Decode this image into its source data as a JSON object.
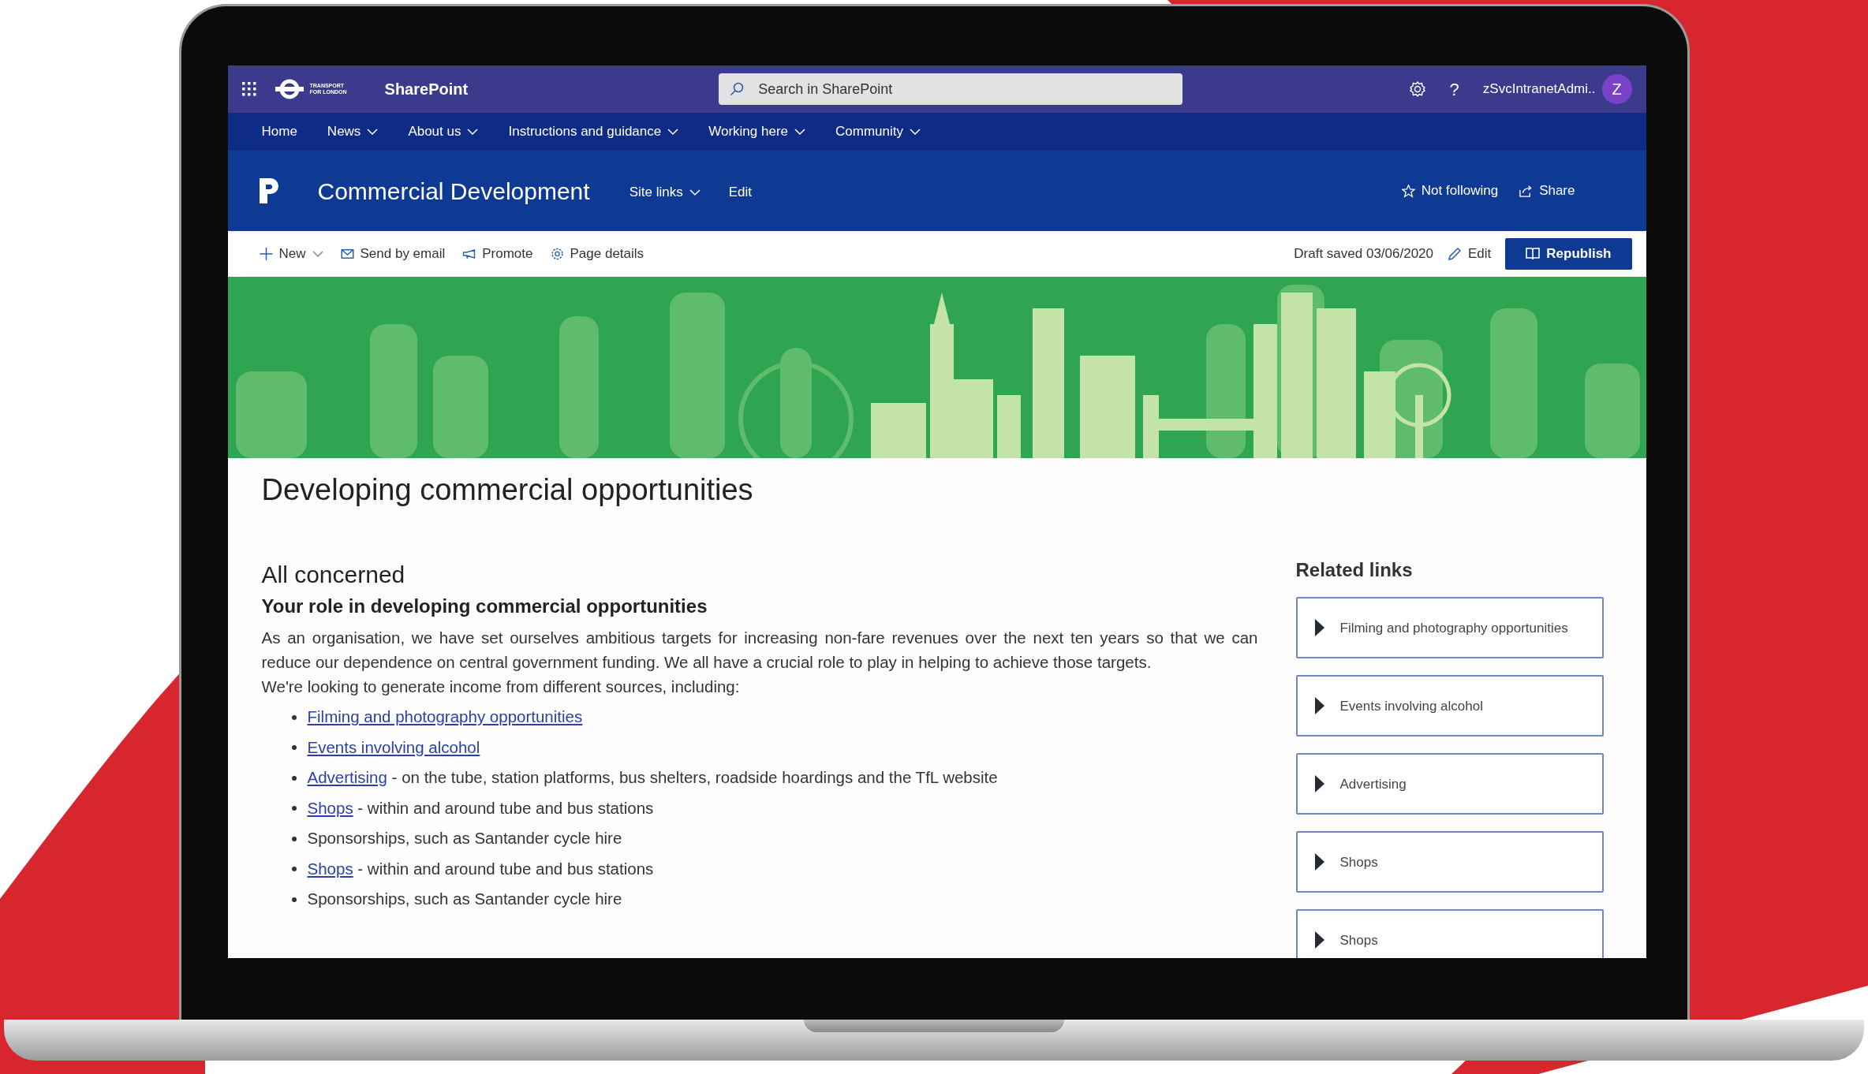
{
  "suite_bar": {
    "logo_text": [
      "TRANSPORT",
      "FOR LONDON"
    ],
    "app_name": "SharePoint",
    "search": {
      "placeholder": "Search in SharePoint"
    },
    "help": "?",
    "user": "zSvcIntranetAdmi..",
    "avatar": "Z"
  },
  "nav": [
    {
      "label": "Home",
      "has_menu": false
    },
    {
      "label": "News",
      "has_menu": true
    },
    {
      "label": "About us",
      "has_menu": true
    },
    {
      "label": "Instructions and guidance",
      "has_menu": true
    },
    {
      "label": "Working here",
      "has_menu": true
    },
    {
      "label": "Community",
      "has_menu": true
    }
  ],
  "site_header": {
    "title": "Commercial Development",
    "links": [
      {
        "label": "Site links",
        "has_menu": true
      },
      {
        "label": "Edit",
        "has_menu": false
      }
    ],
    "actions": [
      {
        "label": "Not following",
        "kind": "follow"
      },
      {
        "label": "Share",
        "kind": "share"
      }
    ]
  },
  "command_bar": {
    "items": [
      {
        "label": "New",
        "kind": "new",
        "has_menu": true
      },
      {
        "label": "Send by email",
        "kind": "email",
        "has_menu": false
      },
      {
        "label": "Promote",
        "kind": "promote",
        "has_menu": false
      },
      {
        "label": "Page details",
        "kind": "details",
        "has_menu": false
      }
    ],
    "status": "Draft saved 03/06/2020",
    "edit": "Edit",
    "primary": "Republish"
  },
  "page": {
    "title": "Developing commercial opportunities",
    "heading": "All concerned",
    "subheading": "Your role in developing commercial opportunities",
    "paragraphs": [
      "As an organisation, we have set ourselves ambitious targets for increasing non-fare revenues over the next ten years so that we can reduce our dependence on central government funding. We all have a crucial role to play in helping to achieve those targets.",
      "We're looking to generate income from different sources, including:"
    ],
    "list": [
      {
        "link": "Filming and photography opportunities"
      },
      {
        "link": "Events involving alcohol"
      },
      {
        "link": "Advertising",
        "text": " - on the tube, station platforms, bus shelters, roadside hoardings and the TfL website"
      },
      {
        "link": "Shops",
        "text": " - within and around tube and bus stations"
      },
      {
        "text": "Sponsorships, such as Santander cycle hire"
      },
      {
        "link": "Shops",
        "text": " - within and around tube and bus stations"
      },
      {
        "text": "Sponsorships, such as Santander cycle hire"
      }
    ]
  },
  "related_links": {
    "title": "Related links",
    "items": [
      "Filming and photography opportunities",
      "Events involving alcohol",
      "Advertising",
      "Shops",
      "Shops"
    ]
  }
}
